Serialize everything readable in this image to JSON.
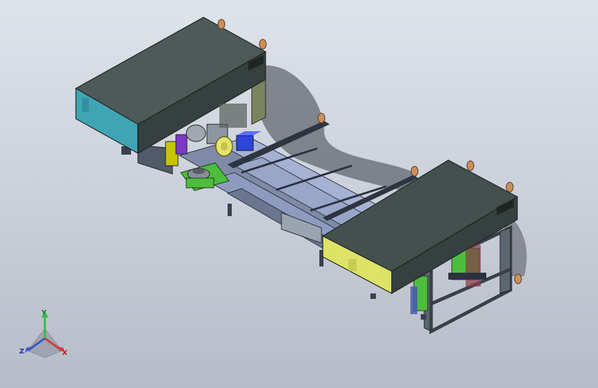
{
  "viewport": {
    "background_top": "#dfe3ea",
    "background_bottom": "#b6bcc8"
  },
  "model": {
    "housing_top_color": "#4e5a58",
    "housing_side_color": "#36403e",
    "left_panel_color": "#3fa5b4",
    "right_panel_color": "#dde366",
    "rail_color": "#98a6c8",
    "frame_color": "#5c6670",
    "green_plate_color": "#4cbd3d",
    "knob_color": "#c98f5e"
  },
  "triad": {
    "y_label": "Y",
    "x_label": "X",
    "z_label": "Z",
    "x_color": "#d33a3a",
    "y_color": "#3ab84a",
    "z_color": "#3a55c8"
  }
}
